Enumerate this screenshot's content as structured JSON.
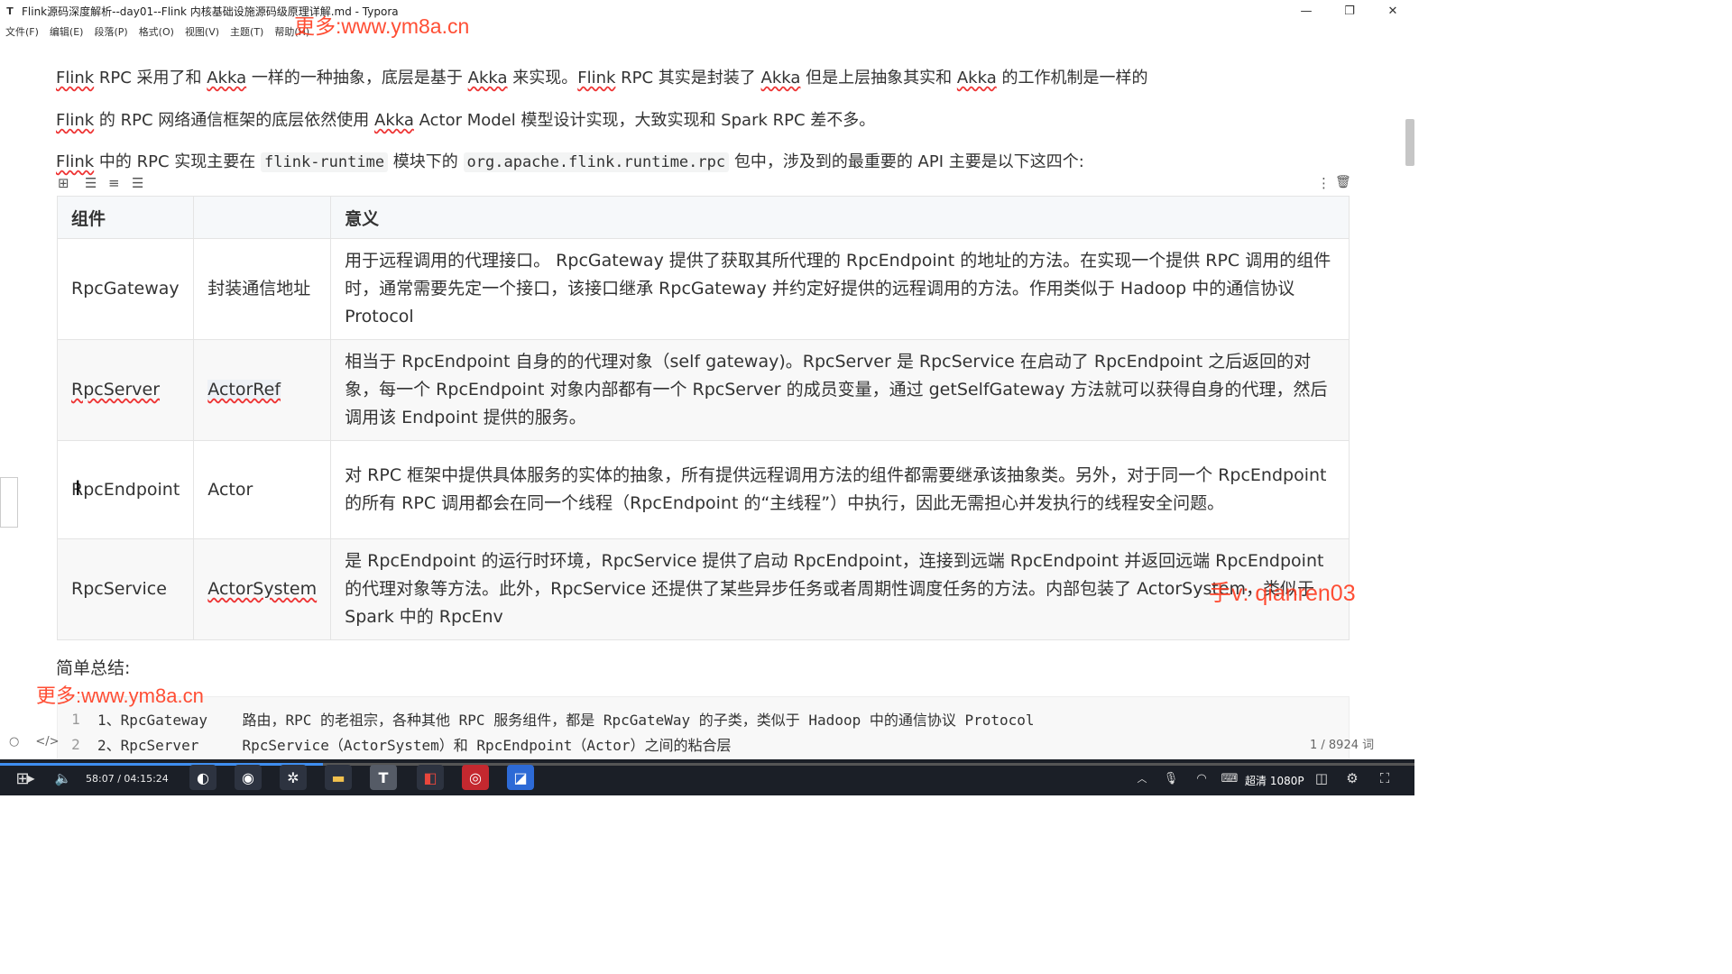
{
  "window": {
    "title": "Flink源码深度解析--day01--Flink 内核基础设施源码级原理详解.md - Typora",
    "app_letter": "T",
    "minimize": "—",
    "maximize": "❐",
    "close": "✕"
  },
  "menu": [
    "文件(F)",
    "编辑(E)",
    "段落(P)",
    "格式(O)",
    "视图(V)",
    "主题(T)",
    "帮助(H)"
  ],
  "watermarks": {
    "top": "更多:www.ym8a.cn",
    "left": "更多:www.ym8a.cn",
    "right": "手v: qianren03"
  },
  "paragraphs": {
    "p1": {
      "s1": "Flink",
      "s2": " RPC 采用了和 ",
      "s3": "Akka",
      "s4": " 一样的一种抽象，底层是基于 ",
      "s5": "Akka",
      "s6": " 来实现。",
      "s7": "Flink",
      "s8": " RPC 其实是封装了 ",
      "s9": "Akka",
      "s10": " 但是上层抽象其实和 ",
      "s11": "Akka",
      "s12": " 的工作机制是一样的"
    },
    "p2": {
      "s1": "Flink",
      "s2": " 的 RPC 网络通信框架的底层依然使用 ",
      "s3": "Akka",
      "s4": " Actor Model 模型设计实现，大致实现和 Spark RPC 差不多。"
    },
    "p3": {
      "s1": "Flink",
      "s2": " 中的 RPC 实现主要在 ",
      "code1": "flink-runtime",
      "s3": " 模块下的 ",
      "code2": "org.apache.flink.runtime.rpc",
      "s4": " 包中，涉及到的最重要的 API 主要是以下这四个:"
    }
  },
  "table_toolbar": {
    "icons": [
      "grid-icon",
      "align-left-icon",
      "align-center-icon",
      "align-right-icon"
    ],
    "glyphs": [
      "⊞",
      "☰",
      "≡",
      "☰"
    ],
    "more": "⋮",
    "delete": "🗑"
  },
  "table": {
    "headers": [
      "组件",
      "",
      "意义"
    ],
    "rows": [
      {
        "c1": "RpcGateway",
        "c2": "封装通信地址",
        "c3": "用于远程调用的代理接口。 RpcGateway 提供了获取其所代理的 RpcEndpoint 的地址的方法。在实现一个提供 RPC 调用的组件时，通常需要先定一个接口，该接口继承 RpcGateway 并约定好提供的远程调用的方法。作用类似于 Hadoop 中的通信协议 Protocol"
      },
      {
        "c1": "RpcServer",
        "c2": "ActorRef",
        "c3": "相当于 RpcEndpoint 自身的的代理对象（self gateway)。RpcServer 是 RpcService 在启动了 RpcEndpoint 之后返回的对象，每一个 RpcEndpoint 对象内部都有一个 RpcServer 的成员变量，通过 getSelfGateway 方法就可以获得自身的代理，然后调用该 Endpoint 提供的服务。"
      },
      {
        "c1": "RpcEndpoint",
        "c2": "Actor",
        "c3": "对 RPC 框架中提供具体服务的实体的抽象，所有提供远程调用方法的组件都需要继承该抽象类。另外，对于同一个 RpcEndpoint 的所有 RPC 调用都会在同一个线程（RpcEndpoint 的“主线程”）中执行，因此无需担心并发执行的线程安全问题。"
      },
      {
        "c1": "RpcService",
        "c2": "ActorSystem",
        "c3": "是 RpcEndpoint 的运行时环境，RpcService 提供了启动 RpcEndpoint，连接到远端 RpcEndpoint 并返回远端 RpcEndpoint 的代理对象等方法。此外，RpcService 还提供了某些异步任务或者周期性调度任务的方法。内部包装了 ActorSystem，类似于 Spark 中的 RpcEnv"
      }
    ]
  },
  "summary_label": "简单总结:",
  "code_lines": [
    {
      "n": "1",
      "text": "1、RpcGateway    路由，RPC 的老祖宗，各种其他 RPC 服务组件，都是 RpcGateWay 的子类，类似于 Hadoop 中的通信协议 Protocol"
    },
    {
      "n": "2",
      "text": "2、RpcServer     RpcService（ActorSystem）和 RpcEndpoint（Actor）之间的粘合层"
    }
  ],
  "status": {
    "circle": "○",
    "source": "</>",
    "word_count": "1 / 8924 词"
  },
  "player": {
    "time": "58:07 / 04:15:24",
    "resolution": "超清 1080P",
    "progress_fraction": 0.228
  },
  "colors": {
    "watermark": "#ff3b1f",
    "taskbar": "#1b1f27",
    "progress": "#3f8ef0"
  }
}
